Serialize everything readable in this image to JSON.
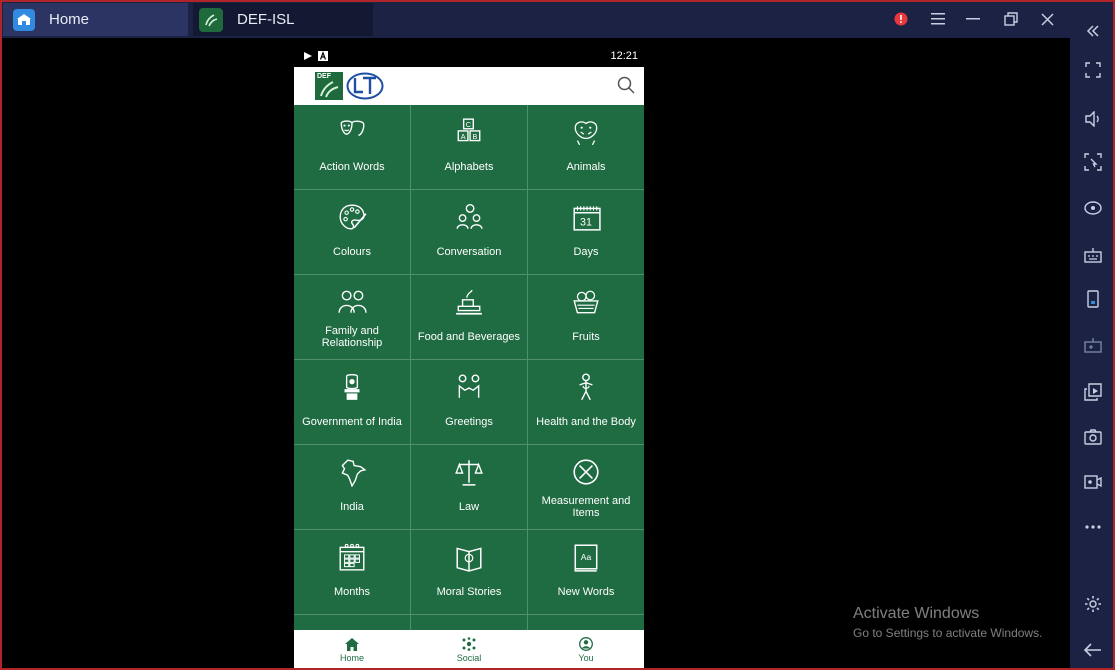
{
  "tabs": {
    "home": {
      "label": "Home"
    },
    "app": {
      "label": "DEF-ISL"
    }
  },
  "window_controls": [
    "alert-icon",
    "menu-icon",
    "minimize-icon",
    "restore-icon",
    "close-icon",
    "collapse-icon"
  ],
  "sidebar_icons": [
    "fullscreen-icon",
    "volume-icon",
    "select-region-icon",
    "eye-icon",
    "keyboard-icon",
    "phone-icon",
    "gamepad-icon",
    "install-apk-icon",
    "screenshot-icon",
    "record-icon",
    "more-icon",
    "settings-icon",
    "back-icon"
  ],
  "phone": {
    "status_time": "12:21",
    "logo_text": "DEF",
    "categories": [
      {
        "label": "Action Words",
        "icon": "masks-icon"
      },
      {
        "label": "Alphabets",
        "icon": "alphabet-blocks-icon"
      },
      {
        "label": "Animals",
        "icon": "animals-icon"
      },
      {
        "label": "Colours",
        "icon": "palette-icon"
      },
      {
        "label": "Conversation",
        "icon": "conversation-icon"
      },
      {
        "label": "Days",
        "icon": "calendar-icon",
        "icon_text": "31"
      },
      {
        "label": "Family and Relationship",
        "icon": "family-icon"
      },
      {
        "label": "Food and Beverages",
        "icon": "food-icon"
      },
      {
        "label": "Fruits",
        "icon": "fruit-basket-icon"
      },
      {
        "label": "Government of India",
        "icon": "emblem-icon"
      },
      {
        "label": "Greetings",
        "icon": "greetings-icon"
      },
      {
        "label": "Health and the Body",
        "icon": "body-icon"
      },
      {
        "label": "India",
        "icon": "india-map-icon"
      },
      {
        "label": "Law",
        "icon": "scales-icon"
      },
      {
        "label": "Measurement and Items",
        "icon": "measurement-icon"
      },
      {
        "label": "Months",
        "icon": "months-calendar-icon"
      },
      {
        "label": "Moral Stories",
        "icon": "book-icon"
      },
      {
        "label": "New Words",
        "icon": "dictionary-icon",
        "icon_text": "Aa"
      },
      {
        "label": "",
        "icon": "numbers-icon"
      },
      {
        "label": "",
        "icon": "opposites-icon"
      },
      {
        "label": "",
        "icon": "emotions-icon"
      }
    ],
    "bottom_nav": [
      {
        "label": "Home",
        "icon": "home-icon"
      },
      {
        "label": "Social",
        "icon": "social-icon"
      },
      {
        "label": "You",
        "icon": "profile-icon"
      }
    ]
  },
  "watermark": {
    "title": "Activate Windows",
    "subtitle": "Go to Settings to activate Windows."
  }
}
